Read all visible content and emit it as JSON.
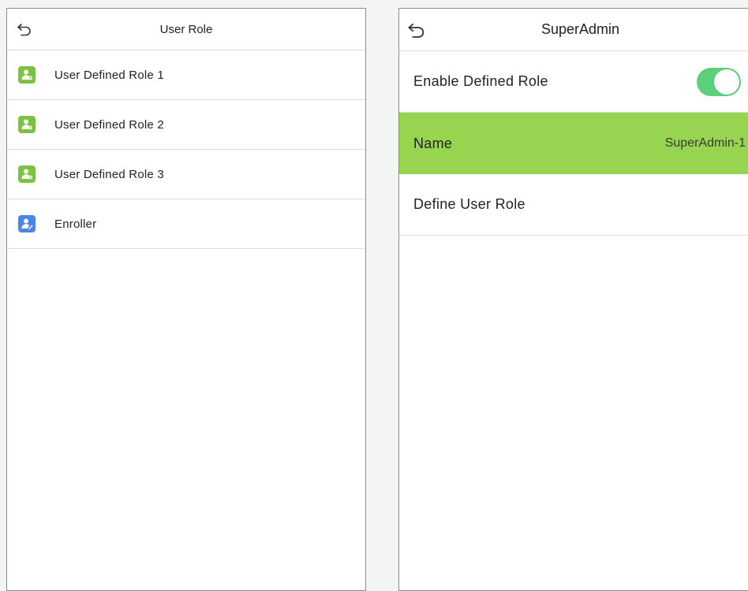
{
  "left_screen": {
    "title": "User Role",
    "back_icon": "back-arrow-icon",
    "items": [
      {
        "label": "User Defined Role 1",
        "icon": "user-role-icon",
        "icon_color": "#7cc242"
      },
      {
        "label": "User Defined Role 2",
        "icon": "user-role-icon",
        "icon_color": "#7cc242"
      },
      {
        "label": "User Defined Role 3",
        "icon": "user-role-icon",
        "icon_color": "#7cc242"
      },
      {
        "label": "Enroller",
        "icon": "enroller-icon",
        "icon_color": "#4a86e8"
      }
    ]
  },
  "right_screen": {
    "title": "SuperAdmin",
    "back_icon": "back-arrow-icon",
    "enable_defined_role": {
      "label": "Enable Defined Role",
      "enabled": true,
      "toggle_color": "#5ad07a"
    },
    "name": {
      "label": "Name",
      "value": "SuperAdmin-1",
      "highlight_color": "#97d44f"
    },
    "define_user_role": {
      "label": "Define User Role"
    }
  }
}
